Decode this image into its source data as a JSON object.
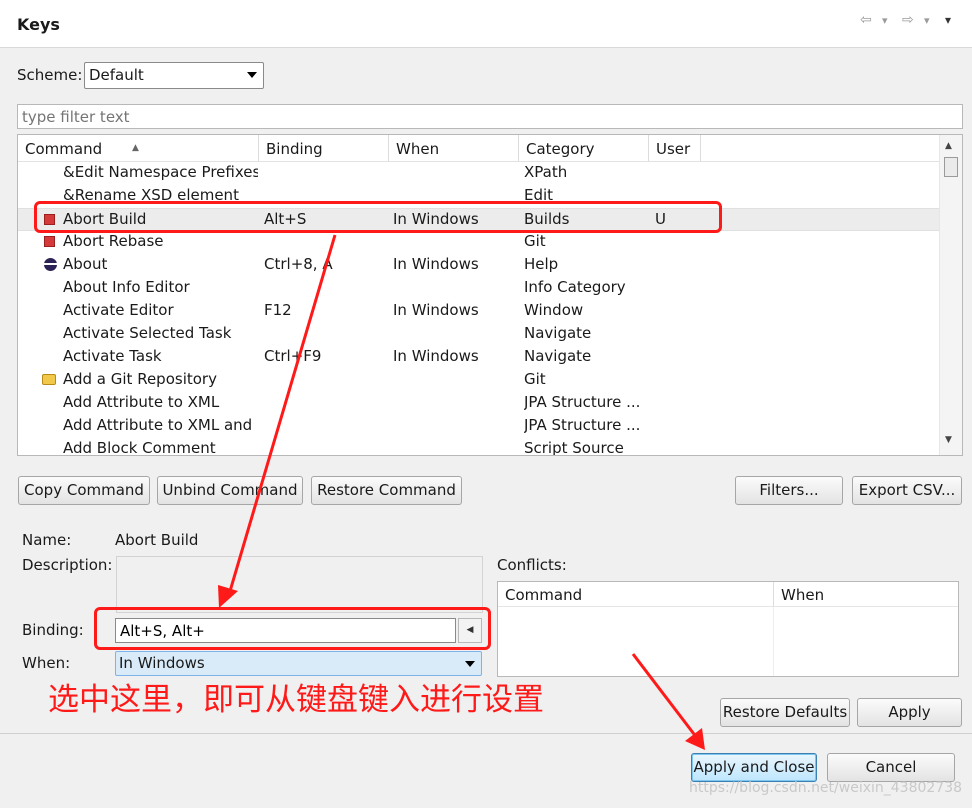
{
  "header": {
    "title": "Keys",
    "nav": {
      "back": "⇦",
      "forward": "⇨",
      "dropdown": "▾",
      "menu": "▾"
    }
  },
  "scheme": {
    "label": "Scheme:",
    "value": "Default"
  },
  "filter": {
    "placeholder": "type filter text"
  },
  "table": {
    "columns": [
      "Command",
      "Binding",
      "When",
      "Category",
      "User"
    ],
    "rows": [
      {
        "command": "&Edit Namespace Prefixes",
        "binding": "",
        "when": "",
        "category": "XPath",
        "user": "",
        "icon": ""
      },
      {
        "command": "&Rename XSD element",
        "binding": "",
        "when": "",
        "category": "Edit",
        "user": "",
        "icon": ""
      },
      {
        "command": "Abort Build",
        "binding": "Alt+S",
        "when": "In Windows",
        "category": "Builds",
        "user": "U",
        "icon": "stop-icon"
      },
      {
        "command": "Abort Rebase",
        "binding": "",
        "when": "",
        "category": "Git",
        "user": "",
        "icon": "stop-icon"
      },
      {
        "command": "About",
        "binding": "Ctrl+8, A",
        "when": "In Windows",
        "category": "Help",
        "user": "",
        "icon": "eclipse-icon"
      },
      {
        "command": "About Info Editor",
        "binding": "",
        "when": "",
        "category": "Info Category",
        "user": "",
        "icon": ""
      },
      {
        "command": "Activate Editor",
        "binding": "F12",
        "when": "In Windows",
        "category": "Window",
        "user": "",
        "icon": ""
      },
      {
        "command": "Activate Selected Task",
        "binding": "",
        "when": "",
        "category": "Navigate",
        "user": "",
        "icon": ""
      },
      {
        "command": "Activate Task",
        "binding": "Ctrl+F9",
        "when": "In Windows",
        "category": "Navigate",
        "user": "",
        "icon": ""
      },
      {
        "command": "Add a Git Repository",
        "binding": "",
        "when": "",
        "category": "Git",
        "user": "",
        "icon": "git-repo-icon"
      },
      {
        "command": "Add Attribute to XML",
        "binding": "",
        "when": "",
        "category": "JPA Structure ...",
        "user": "",
        "icon": ""
      },
      {
        "command": "Add Attribute to XML and I",
        "binding": "",
        "when": "",
        "category": "JPA Structure ...",
        "user": "",
        "icon": ""
      },
      {
        "command": "Add Block Comment",
        "binding": "",
        "when": "",
        "category": "Script Source",
        "user": "",
        "icon": ""
      }
    ]
  },
  "buttons": {
    "copy_command": "Copy Command",
    "unbind_command": "Unbind Command",
    "restore_command": "Restore Command",
    "filters": "Filters...",
    "export_csv": "Export CSV...",
    "restore_defaults": "Restore Defaults",
    "apply": "Apply",
    "apply_and_close": "Apply and Close",
    "cancel": "Cancel"
  },
  "details": {
    "name_label": "Name:",
    "name_value": "Abort Build",
    "description_label": "Description:",
    "binding_label": "Binding:",
    "binding_value": "Alt+S, Alt+",
    "when_label": "When:",
    "when_value": "In Windows",
    "conflicts_label": "Conflicts:",
    "conflicts_columns": [
      "Command",
      "When"
    ]
  },
  "annotation": {
    "text": "选中这里，即可从键盘键入进行设置",
    "color": "#ff1a1a"
  },
  "watermark": "https://blog.csdn.net/weixin_43802738"
}
